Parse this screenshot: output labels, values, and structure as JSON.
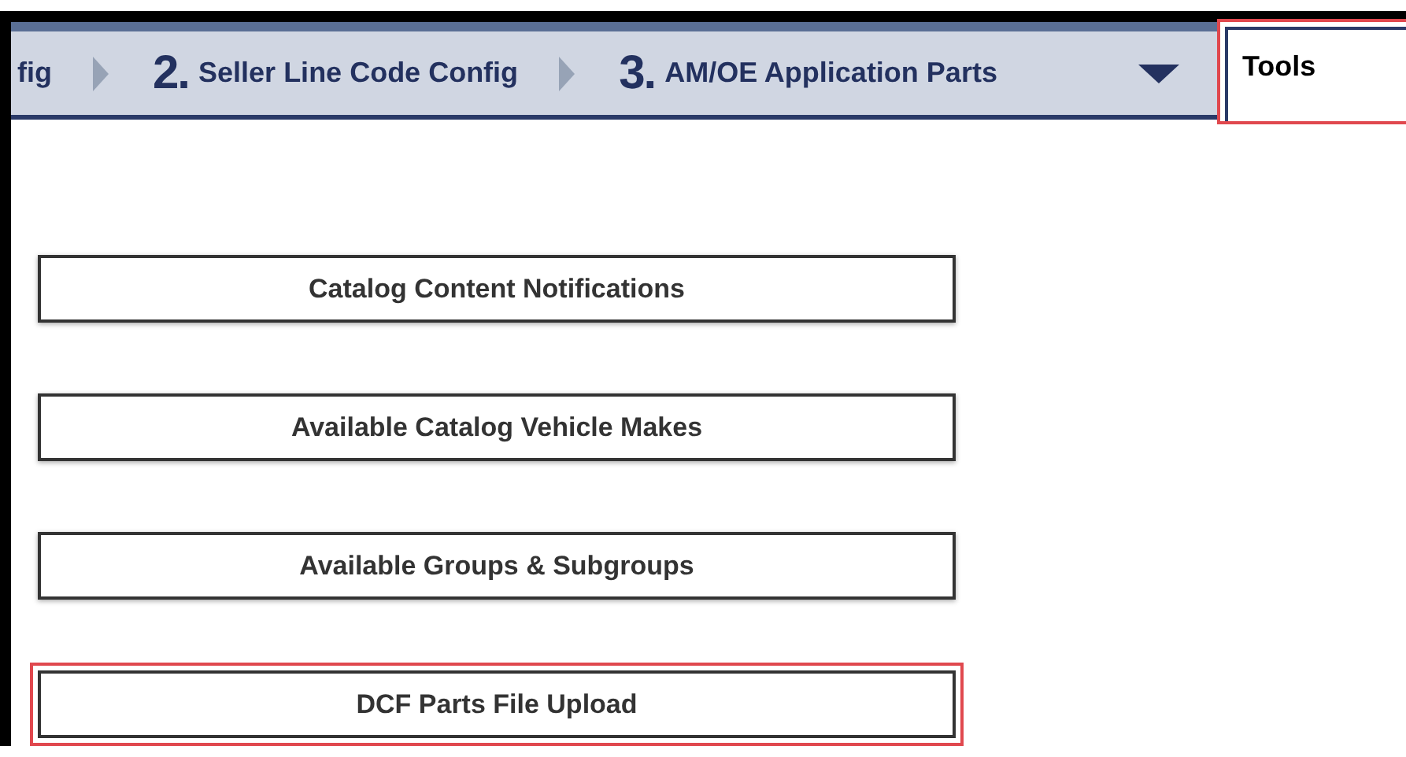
{
  "steps": [
    {
      "label": "fig"
    },
    {
      "number": "2.",
      "label": "Seller Line Code Config"
    },
    {
      "number": "3.",
      "label": "AM/OE Application Parts"
    }
  ],
  "tools_tab": {
    "label": "Tools",
    "selected": true,
    "highlighted": true
  },
  "buttons": [
    {
      "label": "Catalog Content Notifications",
      "highlighted": false
    },
    {
      "label": "Available Catalog Vehicle Makes",
      "highlighted": false
    },
    {
      "label": "Available Groups & Subgroups",
      "highlighted": false
    },
    {
      "label": "DCF Parts File Upload",
      "highlighted": true
    }
  ]
}
